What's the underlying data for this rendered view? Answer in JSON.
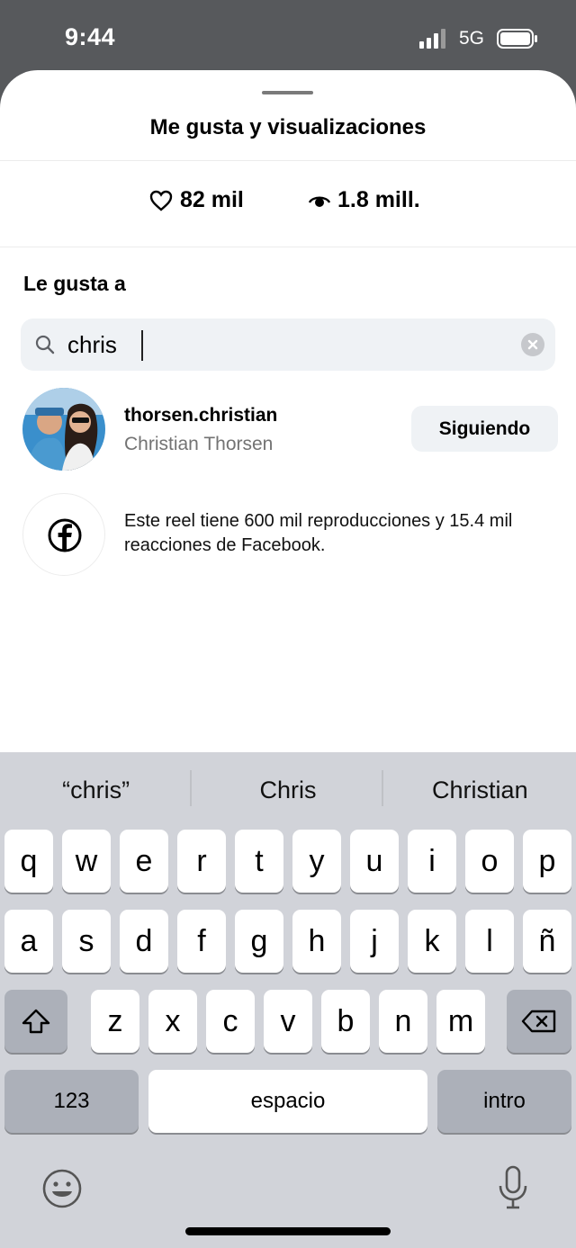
{
  "status": {
    "time": "9:44",
    "network": "5G"
  },
  "sheet": {
    "title": "Me gusta y visualizaciones",
    "likes": "82 mil",
    "views": "1.8 mill.",
    "section_title": "Le gusta a",
    "search_value": "chris",
    "user": {
      "username": "thorsen.christian",
      "full_name": "Christian Thorsen",
      "follow_label": "Siguiendo"
    },
    "facebook_text": "Este reel tiene 600 mil reproducciones y 15.4 mil reacciones de Facebook."
  },
  "keyboard": {
    "suggestions": [
      "“chris”",
      "Chris",
      "Christian"
    ],
    "row1": [
      "q",
      "w",
      "e",
      "r",
      "t",
      "y",
      "u",
      "i",
      "o",
      "p"
    ],
    "row2": [
      "a",
      "s",
      "d",
      "f",
      "g",
      "h",
      "j",
      "k",
      "l",
      "ñ"
    ],
    "row3": [
      "z",
      "x",
      "c",
      "v",
      "b",
      "n",
      "m"
    ],
    "numbers_label": "123",
    "space_label": "espacio",
    "return_label": "intro"
  },
  "colors": {
    "accent_bg": "#eff2f5",
    "keyboard_bg": "#d1d3d9",
    "status_bg": "#57595c"
  },
  "icons": [
    "signal-icon",
    "battery-icon",
    "heart-icon",
    "eye-icon",
    "search-icon",
    "clear-icon",
    "facebook-icon",
    "shift-icon",
    "backspace-icon",
    "emoji-icon",
    "microphone-icon"
  ]
}
